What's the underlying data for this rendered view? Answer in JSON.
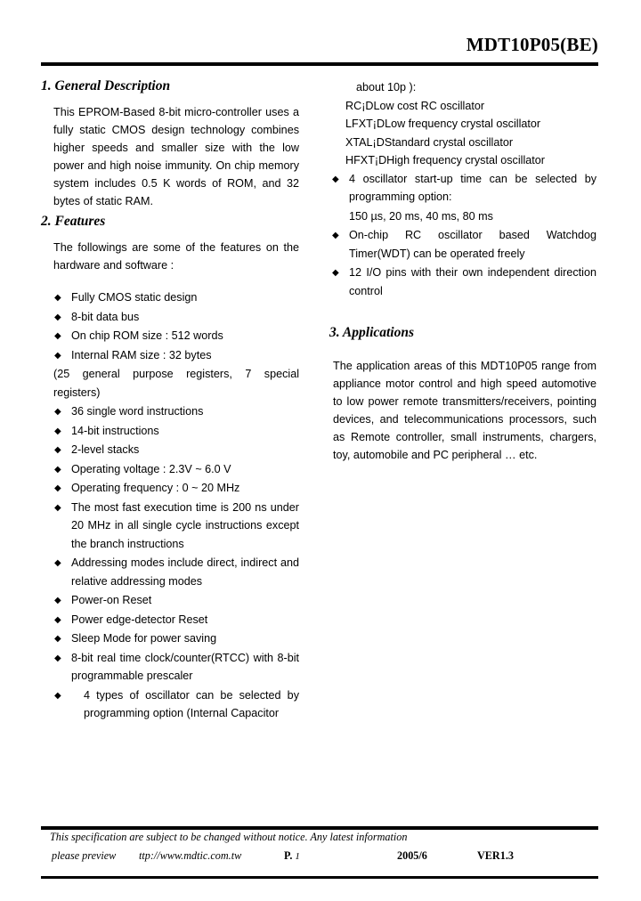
{
  "header": {
    "title": "MDT10P05(BE)"
  },
  "left_column": {
    "section1": {
      "heading": "1. General Description",
      "paragraph": "This EPROM-Based 8-bit micro-controller uses a fully static CMOS design technology combines higher speeds and smaller size with the low power and high noise immunity. On chip memory system includes 0.5 K words of ROM, and 32 bytes of static RAM."
    },
    "section2": {
      "heading": "2. Features",
      "intro": "The followings are some of the features on the hardware and software :",
      "items": [
        {
          "bullet": true,
          "text": "Fully CMOS static design"
        },
        {
          "bullet": true,
          "text": "8-bit data bus"
        },
        {
          "bullet": true,
          "text": "On chip ROM size : 512 words"
        },
        {
          "bullet": true,
          "text": "Internal RAM size : 32 bytes"
        },
        {
          "bullet": false,
          "text": "(25 general purpose registers, 7 special registers)"
        },
        {
          "bullet": true,
          "text": "36 single word instructions"
        },
        {
          "bullet": true,
          "text": "14-bit instructions"
        },
        {
          "bullet": true,
          "text": "2-level stacks"
        },
        {
          "bullet": true,
          "text": "Operating voltage : 2.3V ~ 6.0 V"
        },
        {
          "bullet": true,
          "text": "Operating frequency : 0 ~ 20 MHz"
        },
        {
          "bullet": true,
          "text": "The most fast execution time is 200 ns under 20 MHz in all single cycle instructions except the branch instructions"
        },
        {
          "bullet": true,
          "text": "Addressing modes include direct, indirect and relative addressing modes"
        },
        {
          "bullet": true,
          "text": "Power-on Reset"
        },
        {
          "bullet": true,
          "text": "Power edge-detector Reset"
        },
        {
          "bullet": true,
          "text": "Sleep Mode for power saving"
        },
        {
          "bullet": true,
          "text": "8-bit real time clock/counter(RTCC) with 8-bit programmable prescaler"
        },
        {
          "bullet": true,
          "text": "4 types of oscillator can be selected by programming option (Internal Capacitor"
        }
      ]
    }
  },
  "right_column": {
    "continuation": {
      "line1": "about   10p ):",
      "osc_list": [
        "RC¡DLow cost RC oscillator",
        "LFXT¡DLow frequency crystal oscillator",
        "XTAL¡DStandard crystal oscillator",
        "HFXT¡DHigh frequency crystal oscillator"
      ],
      "items": [
        {
          "bullet": true,
          "text": "4 oscillator start-up time can be selected by programming option:"
        },
        {
          "bullet": false,
          "text": "150 µs, 20 ms, 40 ms, 80 ms"
        },
        {
          "bullet": true,
          "text": "On-chip RC oscillator based Watchdog Timer(WDT) can be operated freely"
        },
        {
          "bullet": true,
          "text": "12 I/O pins with their own independent direction control"
        }
      ]
    },
    "section3": {
      "heading": "3. Applications",
      "paragraph": "The application areas of this MDT10P05 range from appliance motor control and high speed automotive to low power remote transmitters/receivers, pointing devices, and telecommunications processors, such as Remote controller, small instruments, chargers, toy, automobile and PC peripheral … etc."
    }
  },
  "footer": {
    "note": "This specification are subject to be changed without notice. Any latest information",
    "preview": "please preview",
    "url": "ttp://www.mdtic.com.tw",
    "page": "P.",
    "page_num": "1",
    "date": "2005/6",
    "version": "VER1.3"
  }
}
